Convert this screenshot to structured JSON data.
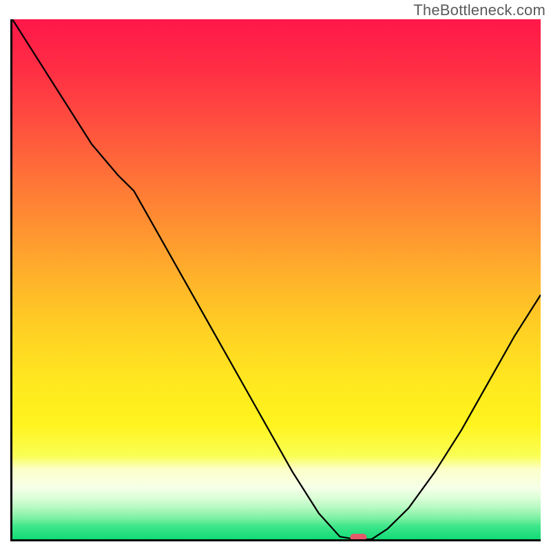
{
  "watermark": "TheBottleneck.com",
  "chart_data": {
    "type": "line",
    "title": "",
    "xlabel": "",
    "ylabel": "",
    "x": [
      0.0,
      0.05,
      0.1,
      0.15,
      0.2,
      0.23,
      0.28,
      0.33,
      0.38,
      0.43,
      0.48,
      0.53,
      0.58,
      0.62,
      0.65,
      0.68,
      0.71,
      0.75,
      0.8,
      0.85,
      0.9,
      0.95,
      1.0
    ],
    "values": [
      1.0,
      0.92,
      0.84,
      0.76,
      0.7,
      0.67,
      0.58,
      0.49,
      0.4,
      0.31,
      0.22,
      0.13,
      0.05,
      0.005,
      0.0,
      0.0,
      0.02,
      0.06,
      0.13,
      0.21,
      0.3,
      0.39,
      0.47
    ],
    "xlim": [
      0,
      1
    ],
    "ylim": [
      0,
      1
    ],
    "min_marker": {
      "x": 0.655,
      "y": 0.0
    },
    "gradient_bands": [
      {
        "pos": 0.0,
        "color": "#ff1749"
      },
      {
        "pos": 0.1,
        "color": "#ff2f44"
      },
      {
        "pos": 0.2,
        "color": "#ff4f3f"
      },
      {
        "pos": 0.3,
        "color": "#ff7138"
      },
      {
        "pos": 0.4,
        "color": "#ff9231"
      },
      {
        "pos": 0.5,
        "color": "#ffb32a"
      },
      {
        "pos": 0.6,
        "color": "#ffd123"
      },
      {
        "pos": 0.7,
        "color": "#ffe81f"
      },
      {
        "pos": 0.78,
        "color": "#fff41e"
      },
      {
        "pos": 0.84,
        "color": "#faff55"
      },
      {
        "pos": 0.865,
        "color": "#fcffc8"
      },
      {
        "pos": 0.9,
        "color": "#f6ffe8"
      },
      {
        "pos": 0.92,
        "color": "#dcffd8"
      },
      {
        "pos": 0.94,
        "color": "#b4f9c0"
      },
      {
        "pos": 0.96,
        "color": "#7bf0a2"
      },
      {
        "pos": 0.975,
        "color": "#3ee68a"
      },
      {
        "pos": 1.0,
        "color": "#12db77"
      }
    ]
  }
}
